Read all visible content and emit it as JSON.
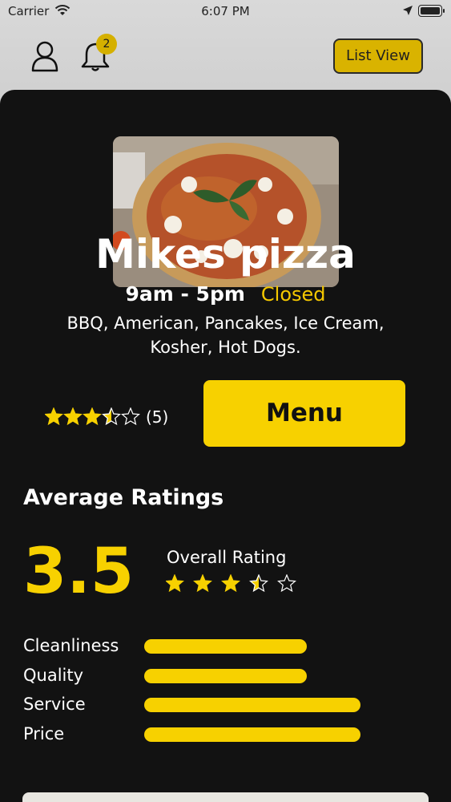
{
  "status_bar": {
    "carrier": "Carrier",
    "time": "6:07 PM"
  },
  "header": {
    "notification_count": "2",
    "list_view_label": "List View"
  },
  "restaurant": {
    "name": "Mikes pizza",
    "hours": "9am - 5pm",
    "open_status": "Closed",
    "cuisines": "BBQ, American, Pancakes, Ice Cream, Kosher, Hot Dogs.",
    "rating": 3.5,
    "review_count": "(5)"
  },
  "menu_button_label": "Menu",
  "average_ratings": {
    "title": "Average Ratings",
    "score": "3.5",
    "overall_label": "Overall Rating",
    "overall_stars": 3.5,
    "categories": [
      {
        "label": "Cleanliness",
        "value": 0.725
      },
      {
        "label": "Quality",
        "value": 0.725
      },
      {
        "label": "Service",
        "value": 0.965
      },
      {
        "label": "Price",
        "value": 0.965
      }
    ]
  },
  "colors": {
    "accent": "#f7d100",
    "card": "#121212",
    "closed": "#f5c800"
  }
}
